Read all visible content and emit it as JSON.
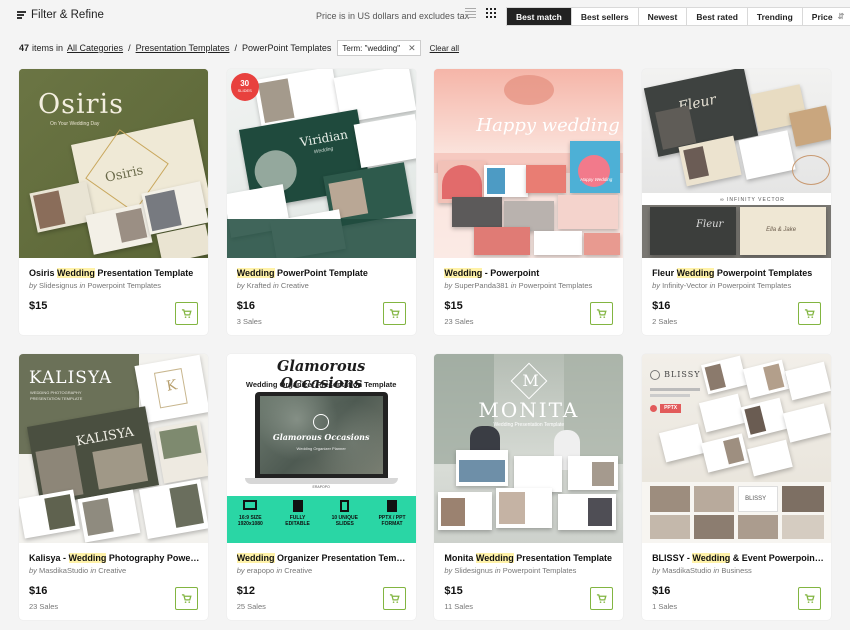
{
  "toolbar": {
    "filter_label": "Filter & Refine",
    "price_note": "Price is in US dollars and excludes tax",
    "sort_options": [
      "Best match",
      "Best sellers",
      "Newest",
      "Best rated",
      "Trending",
      "Price"
    ],
    "active_sort": "Best match",
    "view_icons": [
      "list-view-icon",
      "grid-view-icon"
    ],
    "sort_price_icon": "sort-icon"
  },
  "results": {
    "count": "47",
    "items_in_label": "items in",
    "breadcrumb": [
      "All Categories",
      "Presentation Templates",
      "PowerPoint Templates"
    ],
    "term_chip": "Term: \"wedding\"",
    "term_remove": "✕",
    "clear_all": "Clear all"
  },
  "colors": {
    "accent_green": "#82b541",
    "highlight": "#fff2a8",
    "active_sort_bg": "#222222"
  },
  "products": [
    {
      "title_pre": "Osiris ",
      "title_hl": "Wedding",
      "title_post": " Presentation Template",
      "author": "Slidesignus",
      "category": "Powerpoint Templates",
      "price": "$15",
      "sales": ""
    },
    {
      "title_pre": "",
      "title_hl": "Wedding",
      "title_post": " PowerPoint Template",
      "author": "Krafted",
      "category": "Creative",
      "price": "$16",
      "sales": "3 Sales"
    },
    {
      "title_pre": "",
      "title_hl": "Wedding",
      "title_post": " - Powerpoint",
      "author": "SuperPanda381",
      "category": "Powerpoint Templates",
      "price": "$15",
      "sales": "23 Sales"
    },
    {
      "title_pre": "Fleur ",
      "title_hl": "Wedding",
      "title_post": " Powerpoint Templates",
      "author": "Infinity-Vector",
      "category": "Powerpoint Templates",
      "price": "$16",
      "sales": "2 Sales"
    },
    {
      "title_pre": "Kalisya - ",
      "title_hl": "Wedding",
      "title_post": " Photography Powerp…",
      "author": "MasdikaStudio",
      "category": "Creative",
      "price": "$16",
      "sales": "23 Sales"
    },
    {
      "title_pre": "",
      "title_hl": "Wedding",
      "title_post": " Organizer Presentation Templ…",
      "author": "erapopo",
      "category": "Creative",
      "price": "$12",
      "sales": "25 Sales"
    },
    {
      "title_pre": "Monita ",
      "title_hl": "Wedding",
      "title_post": " Presentation Template",
      "author": "Slidesignus",
      "category": "Powerpoint Templates",
      "price": "$15",
      "sales": "11 Sales"
    },
    {
      "title_pre": "BLISSY - ",
      "title_hl": "Wedding",
      "title_post": " & Event Powerpoint T…",
      "author": "MasdikaStudio",
      "category": "Business",
      "price": "$16",
      "sales": "1 Sales"
    }
  ],
  "by_label": "by",
  "in_label": "in",
  "cart_icon": "cart-icon",
  "thumbs": {
    "osiris": {
      "title": "Osiris",
      "subtitle": "On Your Wedding Day",
      "small_title": "Osiris"
    },
    "viridian": {
      "badge_num": "30",
      "badge_text": "SLIDES",
      "title": "Viridian",
      "subtitle": "Wedding"
    },
    "happy": {
      "title": "Happy wedding",
      "card_text": "Happy Wedding"
    },
    "fleur": {
      "title": "Fleur",
      "brand": "INFINITY VECTOR",
      "bottom_title": "Fleur",
      "names": "Ella & Jake"
    },
    "kalisya": {
      "title": "KALISYA",
      "subtitle": "WEDDING PHOTOGRAPHY PRESENTATION TEMPLATE",
      "slide_title": "KALISYA",
      "monogram": "K"
    },
    "glamorous": {
      "title": "Glamorous Occasions",
      "subtitle": "Wedding Organizer Presentation Template",
      "screen_title": "Glamorous Occasions",
      "screen_sub": "Wedding Organizer Planner",
      "laptop_brand": "ERAPOPO",
      "features": [
        {
          "icon": "monitor-icon",
          "line1": "16:9 SIZE",
          "line2": "1920x1080"
        },
        {
          "icon": "edit-icon",
          "line1": "FULLY",
          "line2": "EDITABLE"
        },
        {
          "icon": "document-icon",
          "line1": "10 UNIQUE",
          "line2": "SLIDES"
        },
        {
          "icon": "file-icon",
          "line1": "PPTX / PPT",
          "line2": "FORMAT"
        }
      ]
    },
    "monita": {
      "monogram": "M",
      "title": "MONITA",
      "subtitle": "Wedding Presentation Template"
    },
    "blissy": {
      "title": "BLISSY",
      "badge": "PPTX",
      "slide_title": "BLISSY"
    }
  }
}
